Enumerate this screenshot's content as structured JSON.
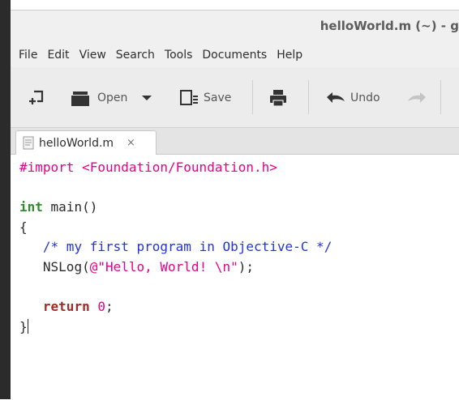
{
  "window": {
    "title": "helloWorld.m (~) - g"
  },
  "menu": [
    "File",
    "Edit",
    "View",
    "Search",
    "Tools",
    "Documents",
    "Help"
  ],
  "toolbar": {
    "open_label": "Open",
    "save_label": "Save",
    "undo_label": "Undo"
  },
  "tab": {
    "label": "helloWorld.m",
    "close": "×"
  },
  "code": {
    "line1": "#import <Foundation/Foundation.h>",
    "int_kw": "int",
    "main_sig": " main()",
    "open_brace": "{",
    "comment": "/* my first program in Objective-C */",
    "nslog_call": "NSLog(",
    "nslog_string": "@\"Hello, World! \\n\"",
    "nslog_end": ");",
    "return_kw": "return",
    "return_val": "0",
    "semicolon": ";",
    "close_brace": "}"
  },
  "colors": {
    "preprocessor": "#e8008a",
    "type_keyword": "#2e8b2e",
    "return_keyword": "#a52a2a",
    "comment": "#2233dd",
    "string": "#e8008a"
  }
}
